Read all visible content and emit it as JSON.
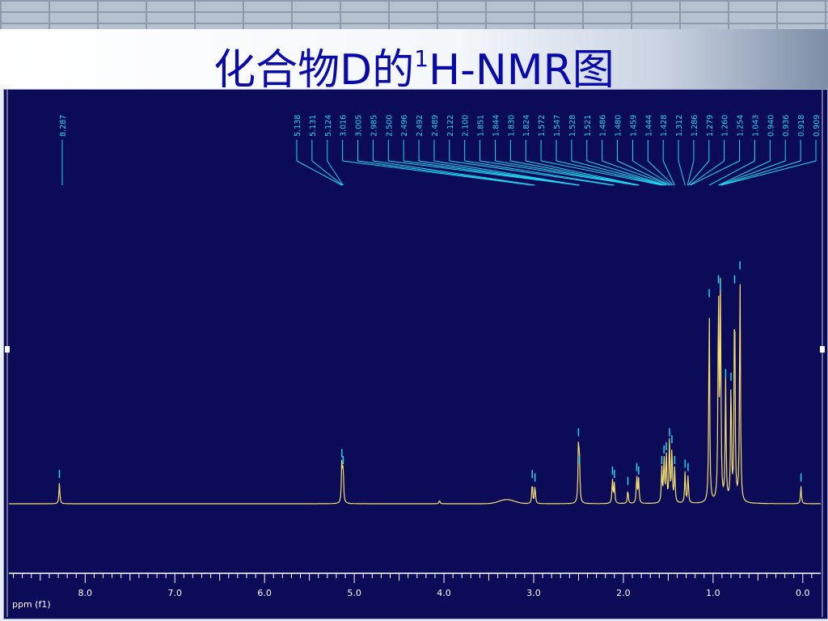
{
  "title": {
    "main": "化合物D的",
    "sup": "1",
    "rest": "H-NMR图"
  },
  "colors": {
    "title": "#0a0aa8",
    "plot_bg": "#0b0b58",
    "spectrum": "#f5e070",
    "peak_labels": "#22d6f0",
    "axis": "#ffffff"
  },
  "chart_data": {
    "type": "line",
    "title": "化合物D的1H-NMR图",
    "xlabel": "ppm (f1)",
    "ylabel": "",
    "x_reversed": true,
    "xlim": [
      8.85,
      -0.2
    ],
    "ticks": [
      "8.0",
      "7.0",
      "6.0",
      "5.0",
      "4.0",
      "3.0",
      "2.0",
      "1.0",
      "0.0"
    ],
    "tick_values": [
      8.0,
      7.0,
      6.0,
      5.0,
      4.0,
      3.0,
      2.0,
      1.0,
      0.0
    ],
    "peak_labels": [
      "8.287",
      "5.138",
      "5.131",
      "5.124",
      "3.016",
      "3.005",
      "2.985",
      "2.500",
      "2.496",
      "2.492",
      "2.489",
      "2.122",
      "2.100",
      "1.851",
      "1.844",
      "1.830",
      "1.824",
      "1.572",
      "1.547",
      "1.528",
      "1.521",
      "1.486",
      "1.480",
      "1.459",
      "1.444",
      "1.428",
      "1.312",
      "1.286",
      "1.279",
      "1.260",
      "1.254",
      "1.043",
      "0.940",
      "0.936",
      "0.918",
      "0.909"
    ],
    "peaks": [
      {
        "ppm": 8.287,
        "height": 0.06
      },
      {
        "ppm": 5.138,
        "height": 0.12
      },
      {
        "ppm": 5.124,
        "height": 0.1
      },
      {
        "ppm": 4.05,
        "height": 0.01
      },
      {
        "ppm": 3.016,
        "height": 0.06
      },
      {
        "ppm": 2.985,
        "height": 0.05
      },
      {
        "ppm": 2.5,
        "height": 0.18
      },
      {
        "ppm": 2.489,
        "height": 0.1
      },
      {
        "ppm": 2.122,
        "height": 0.07
      },
      {
        "ppm": 2.1,
        "height": 0.06
      },
      {
        "ppm": 1.95,
        "height": 0.04
      },
      {
        "ppm": 1.851,
        "height": 0.08
      },
      {
        "ppm": 1.83,
        "height": 0.07
      },
      {
        "ppm": 1.572,
        "height": 0.1
      },
      {
        "ppm": 1.547,
        "height": 0.13
      },
      {
        "ppm": 1.521,
        "height": 0.14
      },
      {
        "ppm": 1.486,
        "height": 0.18
      },
      {
        "ppm": 1.459,
        "height": 0.16
      },
      {
        "ppm": 1.428,
        "height": 0.1
      },
      {
        "ppm": 1.312,
        "height": 0.09
      },
      {
        "ppm": 1.279,
        "height": 0.08
      },
      {
        "ppm": 1.043,
        "height": 0.58
      },
      {
        "ppm": 0.94,
        "height": 0.62
      },
      {
        "ppm": 0.918,
        "height": 0.6
      },
      {
        "ppm": 0.86,
        "height": 0.35
      },
      {
        "ppm": 0.8,
        "height": 0.34
      },
      {
        "ppm": 0.76,
        "height": 0.62
      },
      {
        "ppm": 0.7,
        "height": 0.66
      },
      {
        "ppm": 0.02,
        "height": 0.05
      }
    ]
  }
}
